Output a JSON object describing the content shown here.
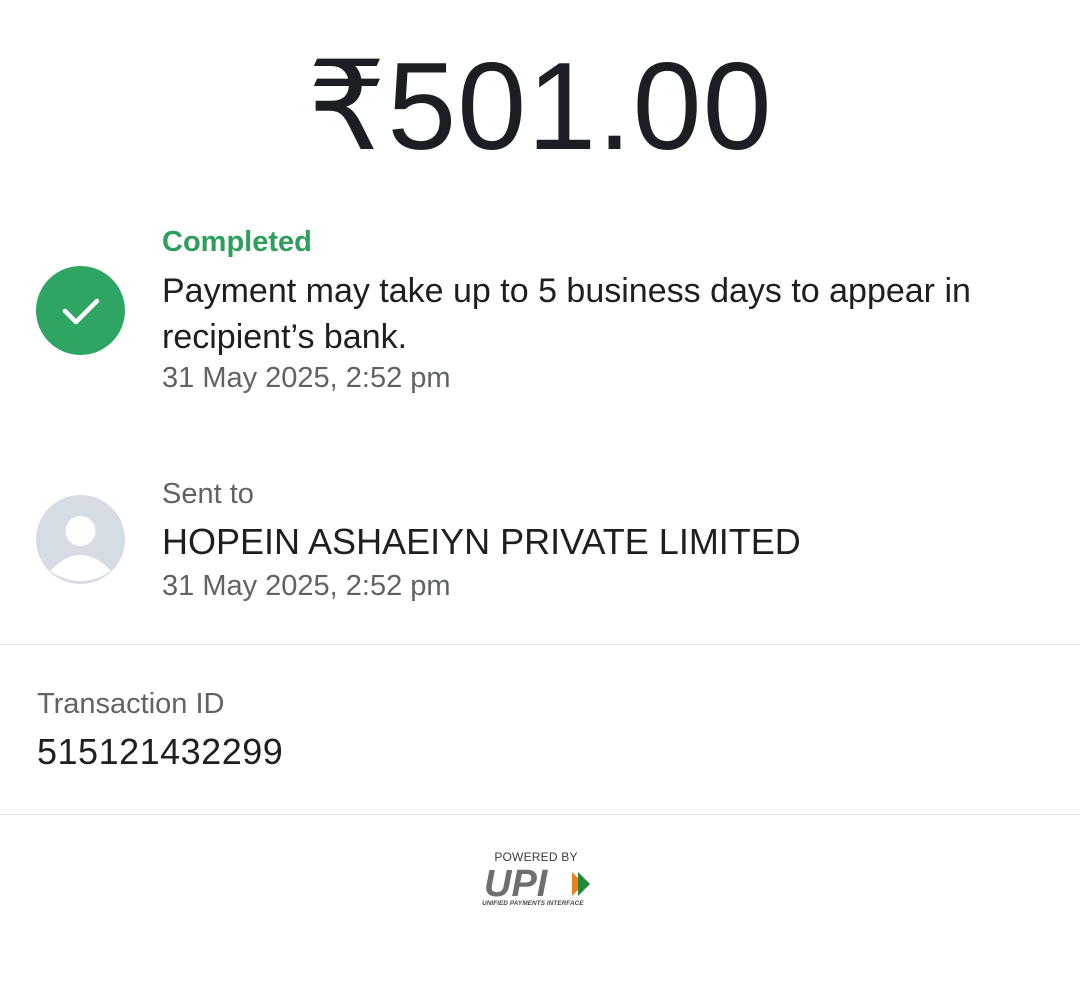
{
  "amount": "₹501.00",
  "status": {
    "label": "Completed",
    "message": "Payment may take up to 5 business days to appear in recipient’s bank.",
    "datetime": "31 May 2025, 2:52 pm",
    "icon": "check-icon",
    "color": "#2ea562"
  },
  "recipient": {
    "label": "Sent to",
    "name": "HOPEIN ASHAEIYN PRIVATE LIMITED",
    "datetime": "31 May 2025, 2:52 pm",
    "icon": "avatar-icon"
  },
  "transaction": {
    "label": "Transaction ID",
    "id": "515121432299"
  },
  "footer": {
    "powered_by": "POWERED BY",
    "brand": "UPI",
    "brand_subtitle": "UNIFIED PAYMENTS INTERFACE"
  }
}
